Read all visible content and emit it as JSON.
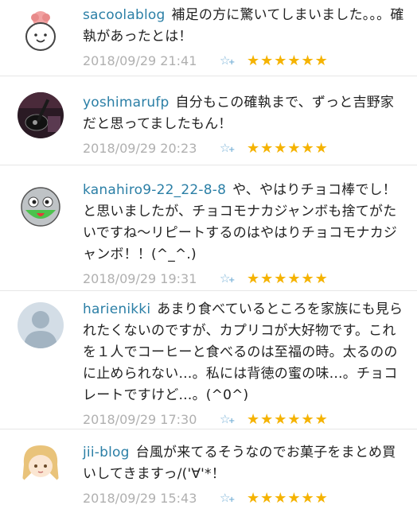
{
  "comments": [
    {
      "user": "sacoolablog",
      "text": "補足の方に驚いてしまいました。。。確執があったとは！",
      "time": "2018/09/29 21:41",
      "add_star_icon": "add-star-icon",
      "stars": "★★★★★★",
      "avatar": "smiling-cartoon-avatar"
    },
    {
      "user": "yoshimarufp",
      "text": "自分もこの確執まで、ずっと吉野家だと思ってましたもん！",
      "time": "2018/09/29 20:23",
      "add_star_icon": "add-star-icon",
      "stars": "★★★★★★",
      "avatar": "guitar-photo-avatar"
    },
    {
      "user": "kanahiro9-22_22-8-8",
      "text": "や、やはりチョコ棒でし！と思いましたが、チョコモナカジャンボも捨てがたいですね〜リピートするのはやはりチョコモナカジャンボ！！(^_^.)",
      "time": "2018/09/29 19:31",
      "add_star_icon": "add-star-icon",
      "stars": "★★★★★★",
      "avatar": "green-character-avatar"
    },
    {
      "user": "harienikki",
      "text": "あまり食べているところを家族にも見られたくないのですが、カプリコが大好物です。これを１人でコーヒーと食べるのは至福の時。太るののに止められない…。私には背徳の蜜の味…。チョコレートですけど…。(^0^)",
      "time": "2018/09/29 17:30",
      "add_star_icon": "add-star-icon",
      "stars": "★★★★★★",
      "avatar": "default-person-avatar"
    },
    {
      "user": "jii-blog",
      "text": "台風が来てるそうなのでお菓子をまとめ買いしてきますっ/('∀'*！",
      "time": "2018/09/29 15:43",
      "add_star_icon": "add-star-icon",
      "stars": "★★★★★★",
      "avatar": "anime-girl-avatar"
    }
  ]
}
